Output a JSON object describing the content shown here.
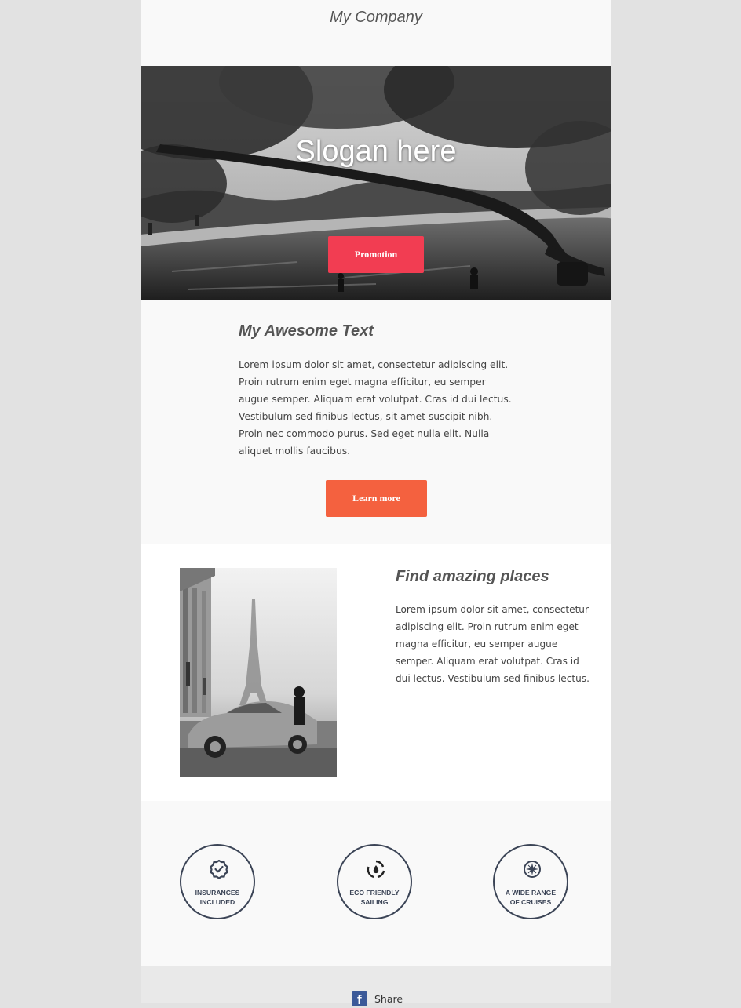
{
  "header": {
    "company": "My Company"
  },
  "hero": {
    "slogan": "Slogan here",
    "button_label": "Promotion"
  },
  "intro": {
    "title": "My Awesome Text",
    "body": "Lorem ipsum dolor sit amet, consectetur adipiscing elit. Proin rutrum enim eget magna efficitur, eu semper augue semper. Aliquam erat volutpat. Cras id dui lectus. Vestibulum sed finibus lectus, sit amet suscipit nibh. Proin nec commodo purus. Sed eget nulla elit. Nulla aliquet mollis faucibus.",
    "button_label": "Learn more"
  },
  "places": {
    "title": "Find amazing places",
    "body": "Lorem ipsum dolor sit amet, consectetur adipiscing elit. Proin rutrum enim eget magna efficitur, eu semper augue semper. Aliquam erat volutpat. Cras id dui lectus. Vestibulum sed finibus lectus."
  },
  "features": [
    {
      "icon": "badge-check-icon",
      "line1": "INSURANCES",
      "line2": "INCLUDED"
    },
    {
      "icon": "eco-cycle-icon",
      "line1": "ECO FRIENDLY",
      "line2": "SAILING"
    },
    {
      "icon": "compass-icon",
      "line1": "A WIDE RANGE",
      "line2": "OF CRUISES"
    }
  ],
  "footer": {
    "share_label": "Share",
    "share_icon": "facebook-icon"
  },
  "colors": {
    "promo_button": "#f23d52",
    "learn_button": "#f4613f",
    "feature_stroke": "#3b4456",
    "facebook": "#3b5998"
  }
}
